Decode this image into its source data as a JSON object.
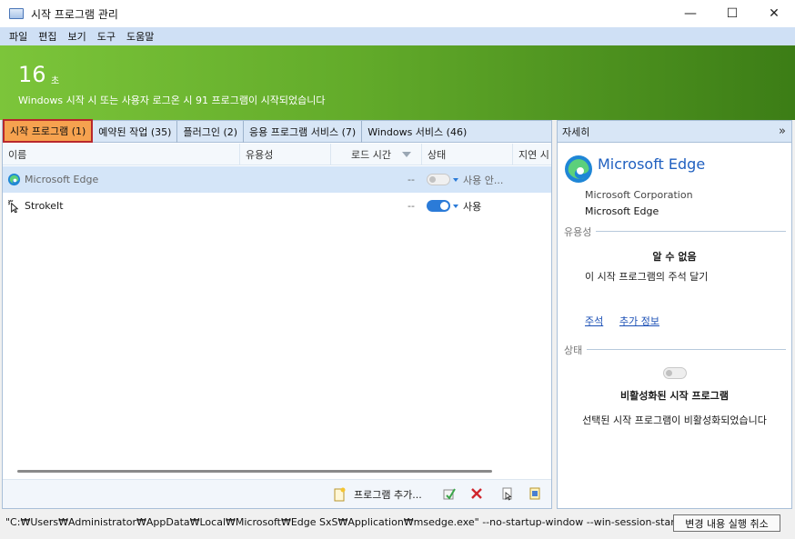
{
  "window": {
    "title": "시작 프로그램 관리",
    "minimize_glyph": "—",
    "maximize_glyph": "☐",
    "close_glyph": "✕"
  },
  "menu": [
    "파일",
    "편집",
    "보기",
    "도구",
    "도움말"
  ],
  "banner": {
    "seconds": "16",
    "unit": "초",
    "message": "Windows 시작 시 또는 사용자 로그온 시 91 프로그램이 시작되었습니다"
  },
  "tabs": [
    {
      "label": "시작 프로그램 (1)",
      "active": true
    },
    {
      "label": "예약된 작업 (35)"
    },
    {
      "label": "플러그인 (2)"
    },
    {
      "label": "응용 프로그램 서비스 (7)"
    },
    {
      "label": "Windows 서비스 (46)"
    }
  ],
  "columns": {
    "name": "이름",
    "usefulness": "유용성",
    "load_time": "로드 시간",
    "status": "상태",
    "delay": "지연 시"
  },
  "rows": [
    {
      "name": "Microsoft Edge",
      "load_time": "--",
      "status": "사용 안...",
      "enabled": false,
      "selected": true,
      "icon": "edge-icon"
    },
    {
      "name": "StrokeIt",
      "load_time": "--",
      "status": "사용",
      "enabled": true,
      "selected": false,
      "icon": "strokeit-icon"
    }
  ],
  "toolbar": {
    "add_label": "프로그램 추가..."
  },
  "details": {
    "header": "자세히",
    "expand_glyph": "»",
    "app_name": "Microsoft Edge",
    "publisher": "Microsoft Corporation",
    "product": "Microsoft Edge",
    "usefulness_section": "유용성",
    "usefulness_value": "알 수 없음",
    "comment_prompt": "이 시작 프로그램의 주석 달기",
    "link_comment": "주석",
    "link_more": "추가 정보",
    "status_section": "상태",
    "status_value": "비활성화된 시작 프로그램",
    "status_desc": "선택된 시작 프로그램이 비활성화되었습니다"
  },
  "statusbar": {
    "command_line": "\"C:₩Users₩Administrator₩AppData₩Local₩Microsoft₩Edge SxS₩Application₩msedge.exe\" --no-startup-window --win-session-start",
    "undo_label": "변경 내용 실행 취소"
  },
  "colors": {
    "accent": "#2b7bd8",
    "active_tab": "#f6a24f",
    "banner_start": "#7cc53a",
    "banner_end": "#3c7d16",
    "link": "#1a4fb5"
  }
}
